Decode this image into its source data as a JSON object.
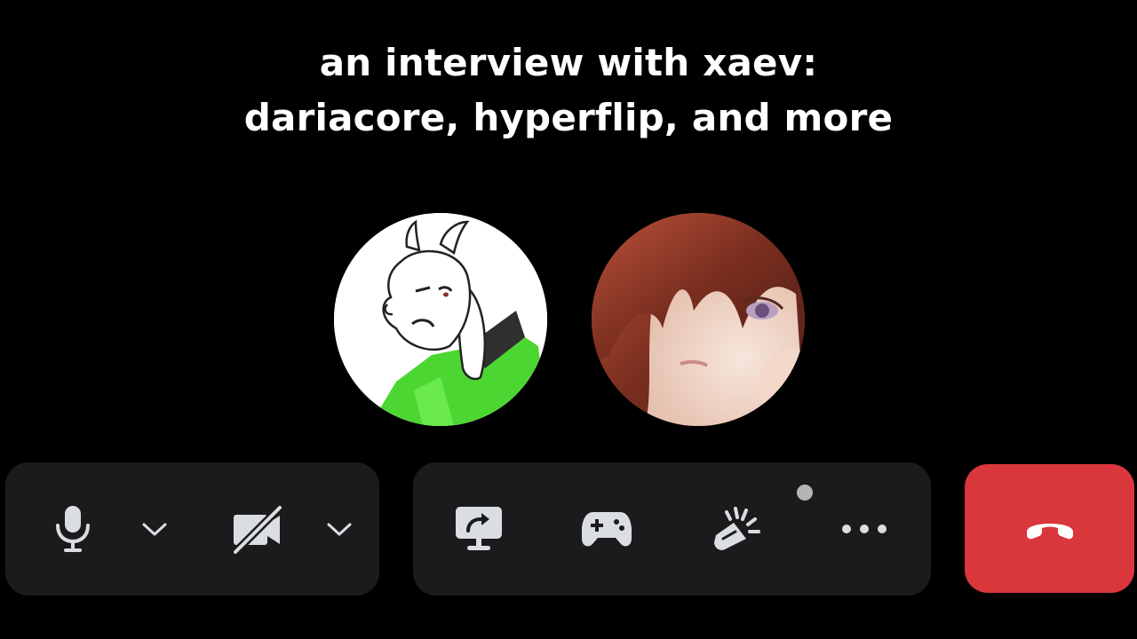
{
  "title": {
    "line1": "an interview with xaev:",
    "line2": "dariacore, hyperflip, and more"
  },
  "participants": [
    {
      "avatar_icon": "goat-character-avatar"
    },
    {
      "avatar_icon": "anime-girl-avatar"
    }
  ],
  "controls": {
    "mic_icon": "microphone-icon",
    "mic_menu_icon": "chevron-down-icon",
    "camera_icon": "camera-off-icon",
    "camera_menu_icon": "chevron-down-icon",
    "screen_share_icon": "screen-share-icon",
    "activities_icon": "gamepad-icon",
    "soundboard_icon": "soundboard-icon",
    "more_icon": "more-options-icon",
    "disconnect_icon": "hang-up-icon"
  },
  "colors": {
    "background": "#000000",
    "panel": "#1b1b1d",
    "icon": "#dbdee1",
    "hangup": "#da373c"
  }
}
